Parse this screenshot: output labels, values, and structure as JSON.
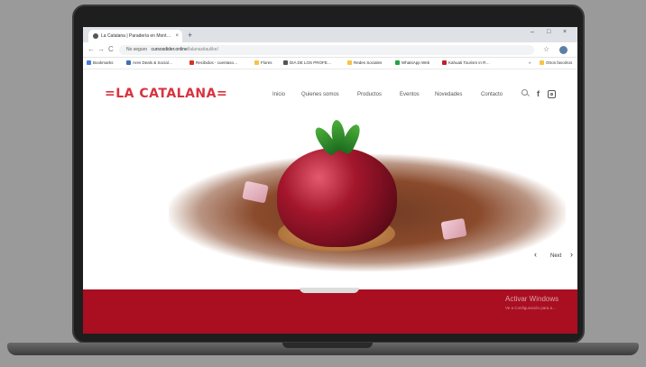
{
  "browser": {
    "tab_title": "La Catalana | Paradería en Mont…",
    "tab_close": "×",
    "new_tab": "+",
    "window_controls": [
      "–",
      "□",
      "×"
    ],
    "nav": [
      "←",
      "→",
      "C"
    ],
    "security_label": "No seguro",
    "url": "cursosdider.online",
    "url_path": "/lalanasitaulike/",
    "star": "☆",
    "bookmarks": [
      "Bookmarks",
      "Ares Deals & Social…",
      "Recibidos - cuentaso…",
      "Flores",
      "DIA DE LOS PROFE…",
      "Redes Sociales",
      "WhatsApp Web",
      "Kahuati Tourism in R…",
      "»",
      "Otros favoritos"
    ]
  },
  "site": {
    "logo": "=LA CATALANA=",
    "nav": [
      "Inicio",
      "Quienes somos",
      "Productos",
      "Eventos",
      "Novedades",
      "Contacto"
    ],
    "slider_next": "Next",
    "prev_arrow": "‹",
    "next_arrow": "›",
    "fb": "f"
  },
  "overlay": {
    "title": "Activar Windows",
    "subtitle": "Ve a Configuración para a…"
  },
  "colors": {
    "brand_red": "#d8333f",
    "band_red": "#a90f21"
  }
}
